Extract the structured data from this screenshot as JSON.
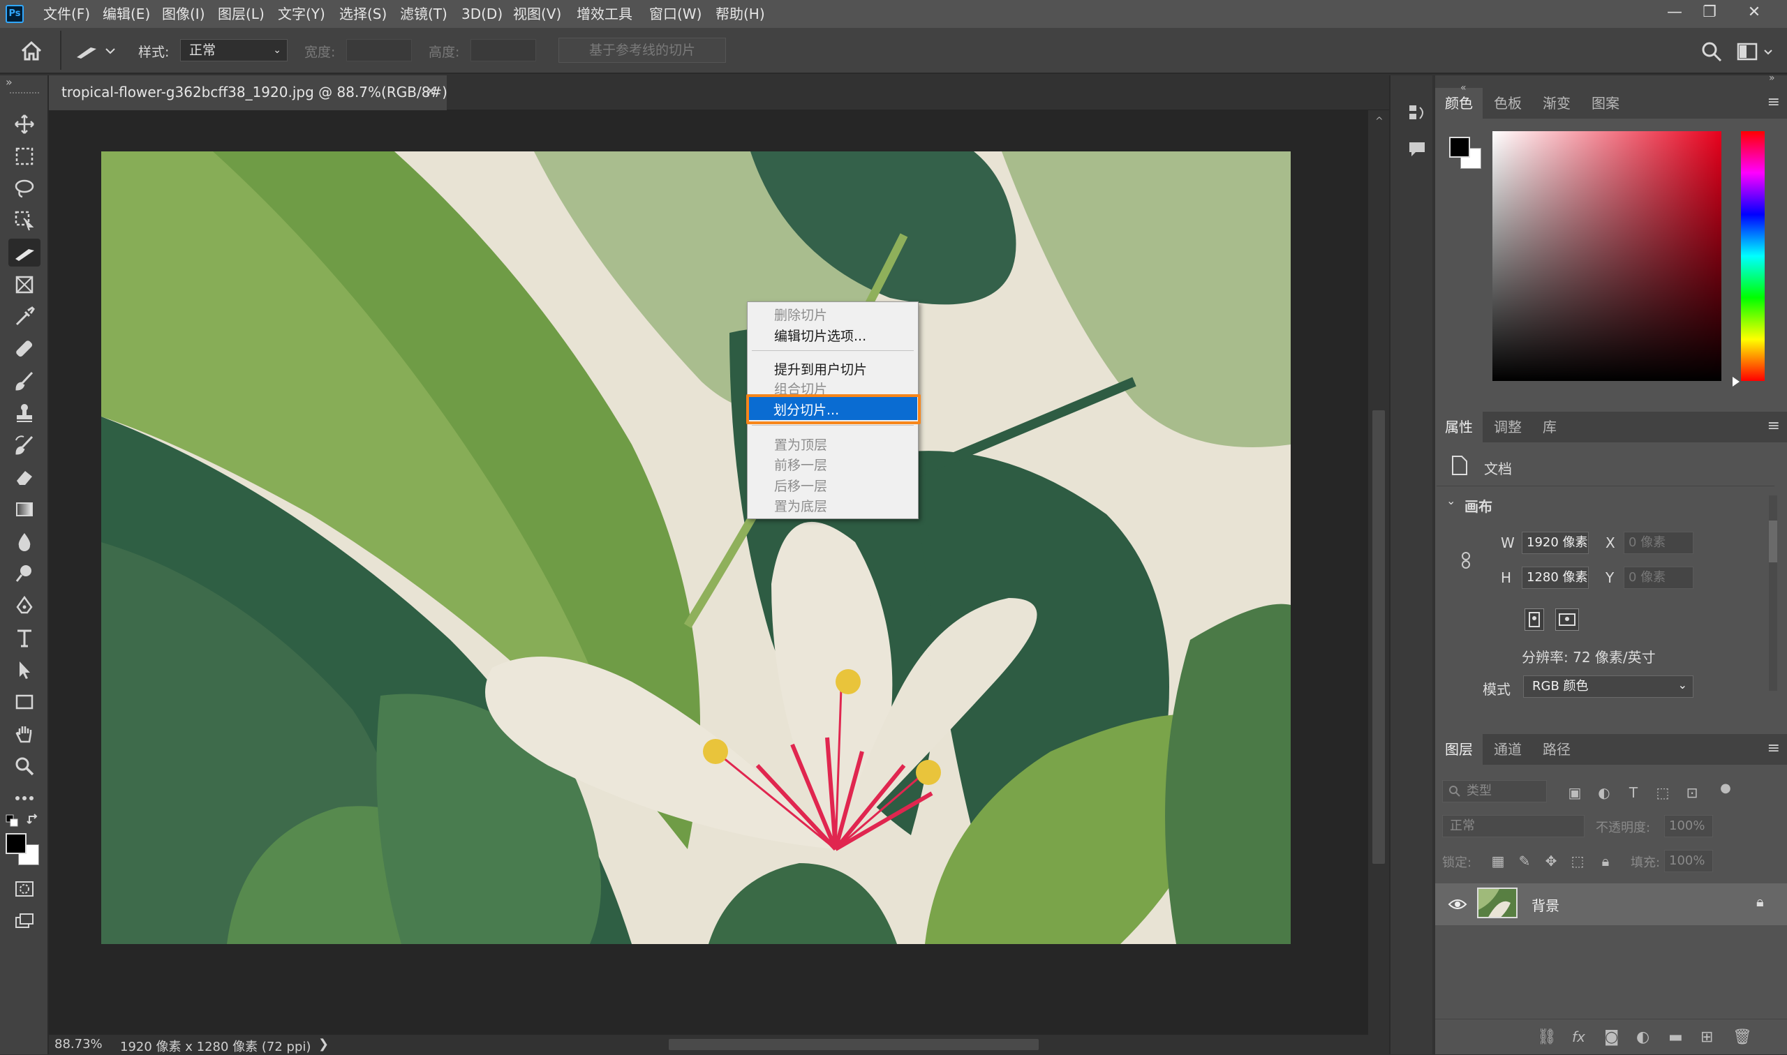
{
  "app": {
    "logo": "Ps"
  },
  "menu": [
    "文件(F)",
    "编辑(E)",
    "图像(I)",
    "图层(L)",
    "文字(Y)",
    "选择(S)",
    "滤镜(T)",
    "3D(D)",
    "视图(V)",
    "增效工具",
    "窗口(W)",
    "帮助(H)"
  ],
  "window_controls": {
    "minimize": "—",
    "restore": "❐",
    "close": "✕"
  },
  "options": {
    "style_label": "样式:",
    "style_value": "正常",
    "width_label": "宽度:",
    "height_label": "高度:",
    "guides_button": "基于参考线的切片"
  },
  "document": {
    "tab_title": "tropical-flower-g362bcff38_1920.jpg @ 88.7%(RGB/8#)",
    "close": "×"
  },
  "status": {
    "zoom": "88.73%",
    "info": "1920 像素 x 1280 像素 (72 ppi)",
    "arrow": "❯"
  },
  "context_menu": {
    "items": [
      {
        "label": "删除切片",
        "enabled": false
      },
      {
        "label": "编辑切片选项...",
        "enabled": true
      },
      {
        "label": "提升到用户切片",
        "enabled": true
      },
      {
        "label": "组合切片",
        "enabled": false
      },
      {
        "label": "划分切片...",
        "enabled": true,
        "highlighted": true
      },
      {
        "label": "置为顶层",
        "enabled": false
      },
      {
        "label": "前移一层",
        "enabled": false
      },
      {
        "label": "后移一层",
        "enabled": false
      },
      {
        "label": "置为底层",
        "enabled": false
      }
    ]
  },
  "color_panel": {
    "tabs": [
      "颜色",
      "色板",
      "渐变",
      "图案"
    ],
    "foreground": "#000000",
    "background": "#ffffff",
    "hue_color": "#e8001c"
  },
  "properties_panel": {
    "tabs": [
      "属性",
      "调整",
      "库"
    ],
    "doc_label": "文档",
    "section": "画布",
    "w_label": "W",
    "w_value": "1920 像素",
    "h_label": "H",
    "h_value": "1280 像素",
    "x_label": "X",
    "x_placeholder": "0 像素",
    "y_label": "Y",
    "y_placeholder": "0 像素",
    "resolution": "分辨率: 72 像素/英寸",
    "mode_label": "模式",
    "mode_value": "RGB 颜色"
  },
  "layers_panel": {
    "tabs": [
      "图层",
      "通道",
      "路径"
    ],
    "filter_placeholder": "类型",
    "blend_mode": "正常",
    "opacity_label": "不透明度:",
    "opacity_value": "100%",
    "lock_label": "锁定:",
    "fill_label": "填充:",
    "fill_value": "100%",
    "layer_name": "背景"
  }
}
